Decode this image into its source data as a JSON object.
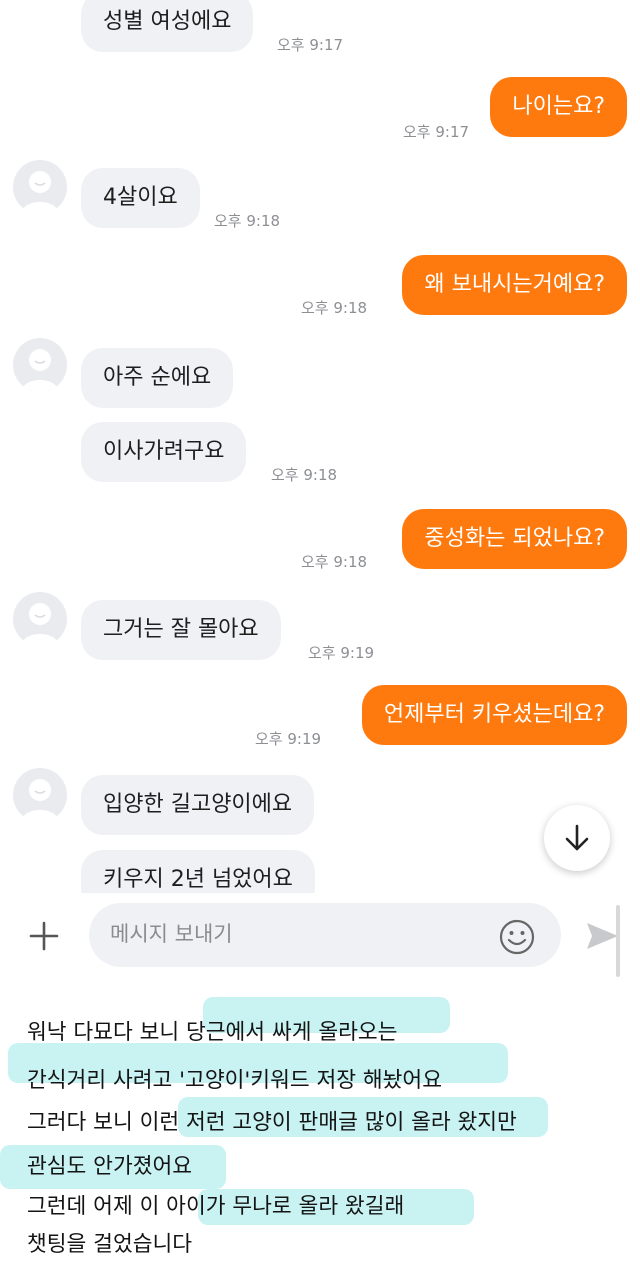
{
  "messages": [
    {
      "text": "성별 여성에요",
      "time": "오후 9:17"
    },
    {
      "text": "나이는요?",
      "time": "오후 9:17"
    },
    {
      "text": "4살이요",
      "time": "오후 9:18"
    },
    {
      "text": "왜 보내시는거예요?",
      "time": "오후 9:18"
    },
    {
      "text": "아주 순에요"
    },
    {
      "text": "이사가려구요",
      "time": "오후 9:18"
    },
    {
      "text": "중성화는 되었나요?",
      "time": "오후 9:18"
    },
    {
      "text": "그거는 잘 몰아요",
      "time": "오후 9:19"
    },
    {
      "text": "언제부터 키우셨는데요?",
      "time": "오후 9:19"
    },
    {
      "text": "입양한 길고양이에요"
    },
    {
      "text": "키우지 2년 넘었어요"
    }
  ],
  "composer": {
    "placeholder": "메시지 보내기"
  },
  "icons": {
    "add": "plus-icon",
    "emoji": "emoji-icon",
    "send": "send-icon",
    "scroll": "arrow-down-icon",
    "avatar": "avatar-placeholder-icon"
  },
  "colors": {
    "outgoing": "#ff7a0e",
    "incoming": "#f0f1f4",
    "highlight": "#bff0f0"
  },
  "caption": [
    "워낙 다묘다 보니 당근에서 싸게 올라오는",
    "간식거리 사려고 '고양이'키워드 저장 해놨어요",
    "그러다 보니 이런 저런 고양이 판매글 많이 올라 왔지만",
    "관심도 안가졌어요",
    "그런데 어제 이 아이가   무나로 올라 왔길래",
    "챗팅을 걸었습니다"
  ]
}
